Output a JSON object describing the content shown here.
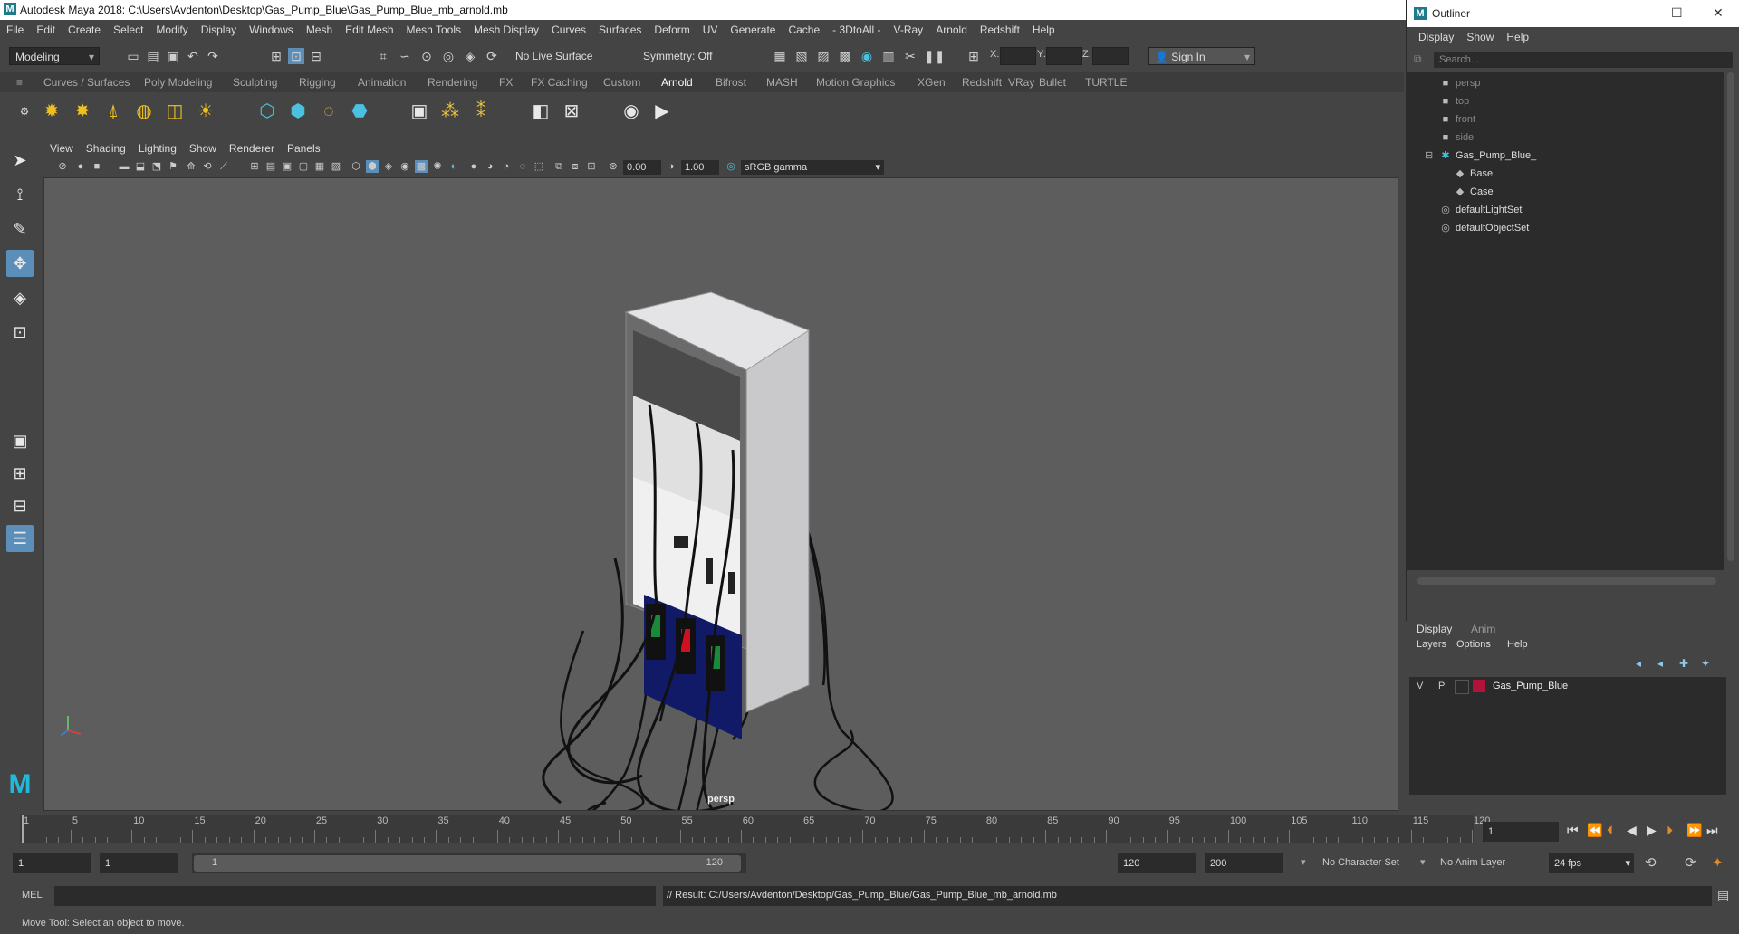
{
  "window": {
    "title": "Autodesk Maya 2018: C:\\Users\\Avdenton\\Desktop\\Gas_Pump_Blue\\Gas_Pump_Blue_mb_arnold.mb"
  },
  "menubar": [
    "File",
    "Edit",
    "Create",
    "Select",
    "Modify",
    "Display",
    "Windows",
    "Mesh",
    "Edit Mesh",
    "Mesh Tools",
    "Mesh Display",
    "Curves",
    "Surfaces",
    "Deform",
    "UV",
    "Generate",
    "Cache",
    "- 3DtoAll -",
    "V-Ray",
    "Arnold",
    "Redshift",
    "Help"
  ],
  "toolbar": {
    "mode": "Modeling",
    "live_surface": "No Live Surface",
    "symmetry": "Symmetry: Off",
    "x_label": "X:",
    "y_label": "Y:",
    "z_label": "Z:",
    "sign_in": "Sign In"
  },
  "shelf_tabs": [
    "Curves / Surfaces",
    "Poly Modeling",
    "Sculpting",
    "Rigging",
    "Animation",
    "Rendering",
    "FX",
    "FX Caching",
    "Custom",
    "Arnold",
    "Bifrost",
    "MASH",
    "Motion Graphics",
    "XGen",
    "Redshift",
    "VRay",
    "Bullet",
    "TURTLE"
  ],
  "active_shelf": "Arnold",
  "viewport": {
    "menu": [
      "View",
      "Shading",
      "Lighting",
      "Show",
      "Renderer",
      "Panels"
    ],
    "exposure": "0.00",
    "gamma": "1.00",
    "color_space": "sRGB gamma",
    "camera": "persp"
  },
  "outliner": {
    "title": "Outliner",
    "menu": [
      "Display",
      "Show",
      "Help"
    ],
    "search_placeholder": "Search...",
    "items": [
      {
        "label": "persp",
        "icon": "camera-icon",
        "dim": true,
        "indent": 0
      },
      {
        "label": "top",
        "icon": "camera-icon",
        "dim": true,
        "indent": 0
      },
      {
        "label": "front",
        "icon": "camera-icon",
        "dim": true,
        "indent": 0
      },
      {
        "label": "side",
        "icon": "camera-icon",
        "dim": true,
        "indent": 0
      },
      {
        "label": "Gas_Pump_Blue_",
        "icon": "group-icon",
        "dim": false,
        "indent": 0,
        "expanded": true
      },
      {
        "label": "Base",
        "icon": "mesh-icon",
        "dim": false,
        "indent": 1
      },
      {
        "label": "Case",
        "icon": "mesh-icon",
        "dim": false,
        "indent": 1
      },
      {
        "label": "defaultLightSet",
        "icon": "set-icon",
        "dim": false,
        "indent": 0
      },
      {
        "label": "defaultObjectSet",
        "icon": "set-icon",
        "dim": false,
        "indent": 0
      }
    ]
  },
  "layers": {
    "tabs": [
      "Display",
      "Anim"
    ],
    "menu": [
      "Layers",
      "Options",
      "Help"
    ],
    "rows": [
      {
        "v": "V",
        "p": "P",
        "name": "Gas_Pump_Blue",
        "color": "#b3123a"
      }
    ]
  },
  "timeline": {
    "ticks": [
      1,
      5,
      10,
      15,
      20,
      25,
      30,
      35,
      40,
      45,
      50,
      55,
      60,
      65,
      70,
      75,
      80,
      85,
      90,
      95,
      100,
      105,
      110,
      115,
      120
    ],
    "current_frame": "1",
    "range_start": "1",
    "playback_start": "1",
    "range_bar_start": "1",
    "range_bar_end": "120",
    "playback_end": "120",
    "range_end": "200",
    "character_set": "No Character Set",
    "anim_layer": "No Anim Layer",
    "fps": "24 fps"
  },
  "cmd": {
    "label": "MEL",
    "result": "// Result: C:/Users/Avdenton/Desktop/Gas_Pump_Blue/Gas_Pump_Blue_mb_arnold.mb"
  },
  "status": "Move Tool: Select an object to move."
}
